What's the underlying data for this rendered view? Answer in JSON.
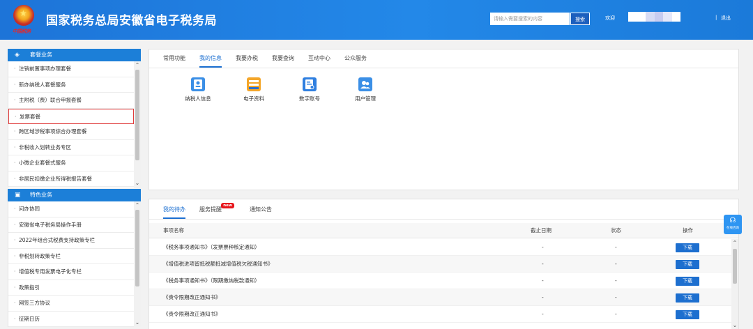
{
  "header": {
    "seal_text": "中国税务",
    "title": "国家税务总局安徽省电子税务局",
    "search_placeholder": "请输入需要搜索的内容",
    "search_button": "搜索",
    "welcome": "欢迎",
    "separator": "|",
    "logout": "退出"
  },
  "sidebar": {
    "group1": {
      "title": "套餐业务",
      "items": [
        "注销前置事项办理套餐",
        "新办纳税人套餐服务",
        "主附税（费）联合申报套餐",
        "发票套餐",
        "跨区域涉税事项综合办理套餐",
        "非税收入划转业务专区",
        "小微企业套餐式服务",
        "非居民扣缴企业所得税报告套餐"
      ]
    },
    "group2": {
      "title": "特色业务",
      "items": [
        "问办协同",
        "安徽省电子税务局操作手册",
        "2022年组合式税费支持政策专栏",
        "非税划转政策专栏",
        "增值税专用发票电子化专栏",
        "政策指引",
        "网签三方协议",
        "征期日历"
      ]
    }
  },
  "info_panel": {
    "tabs": [
      "常用功能",
      "我的信息",
      "我要办税",
      "我要查询",
      "互动中心",
      "公众服务"
    ],
    "active_tab": "我的信息",
    "apps": [
      {
        "label": "纳税人信息",
        "icon": "user-card-icon"
      },
      {
        "label": "电子资料",
        "icon": "document-stack-icon"
      },
      {
        "label": "数字账号",
        "icon": "digital-account-icon"
      },
      {
        "label": "用户管理",
        "icon": "user-group-icon"
      }
    ]
  },
  "todo_panel": {
    "tabs": [
      "我的待办",
      "服务提醒",
      "通知公告"
    ],
    "active_tab": "我的待办",
    "new_badge": "new",
    "columns": {
      "name": "事项名称",
      "deadline": "截止日期",
      "status": "状态",
      "action": "操作"
    },
    "rows": [
      {
        "name": "《税务事项通知书》（发票票种核定通知）",
        "deadline": "-",
        "status": "-",
        "action": "下载"
      },
      {
        "name": "《增值税进项留抵税额抵减增值税欠税通知书》",
        "deadline": "-",
        "status": "-",
        "action": "下载"
      },
      {
        "name": "《税务事项通知书》（限期缴纳税款通知）",
        "deadline": "-",
        "status": "-",
        "action": "下载"
      },
      {
        "name": "《责令限期改正通知书》",
        "deadline": "-",
        "status": "-",
        "action": "下载"
      },
      {
        "name": "《责令限期改正通知书》",
        "deadline": "-",
        "status": "-",
        "action": "下载"
      }
    ]
  },
  "float_help": {
    "label": "在线咨询"
  },
  "colors": {
    "header_blue": "#2388e8",
    "accent_blue": "#1b6fd1",
    "highlight_red": "#e03b3b",
    "new_badge": "#e7161c"
  }
}
